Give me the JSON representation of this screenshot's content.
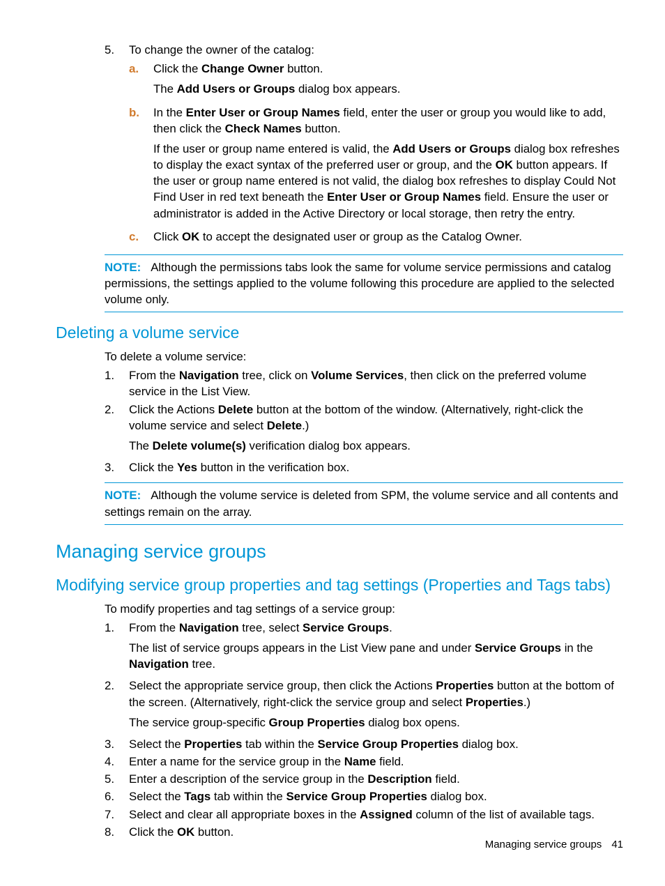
{
  "top": {
    "step5_num": "5.",
    "step5_text": "To change the owner of the catalog:",
    "sub": {
      "a_mk": "a.",
      "a_line1_pre": "Click the ",
      "a_line1_b1": "Change Owner",
      "a_line1_post": " button.",
      "a_line2_pre": "The ",
      "a_line2_b1": "Add Users or Groups",
      "a_line2_post": " dialog box appears.",
      "b_mk": "b.",
      "b_line1_pre": "In the ",
      "b_line1_b1": "Enter User or Group Names",
      "b_line1_mid": " field, enter the user or group you would like to add, then click the ",
      "b_line1_b2": "Check Names",
      "b_line1_post": " button.",
      "b_line2_pre": "If the user or group name entered is valid, the ",
      "b_line2_b1": "Add Users or Groups",
      "b_line2_mid1": " dialog box refreshes to display the exact syntax of the preferred user or group, and the ",
      "b_line2_b2": "OK",
      "b_line2_mid2": " button appears. If the user or group name entered is not valid, the dialog box refreshes to display Could Not Find User in red text beneath the ",
      "b_line2_b3": "Enter User or Group Names",
      "b_line2_post": " field. Ensure the user or administrator is added in the Active Directory or local storage, then retry the entry.",
      "c_mk": "c.",
      "c_line1_pre": "Click ",
      "c_line1_b1": "OK",
      "c_line1_post": " to accept the designated user or group as the Catalog Owner."
    },
    "note1_label": "NOTE:",
    "note1_text": "Although the permissions tabs look the same for volume service permissions and catalog permissions, the settings applied to the volume following this procedure are applied to the selected volume only."
  },
  "del": {
    "heading": "Deleting a volume service",
    "intro": "To delete a volume service:",
    "s1_num": "1.",
    "s1_pre": "From the ",
    "s1_b1": "Navigation",
    "s1_mid": " tree, click on ",
    "s1_b2": "Volume Services",
    "s1_post": ", then click on the preferred volume service in the List View.",
    "s2_num": "2.",
    "s2_pre": "Click the Actions ",
    "s2_b1": "Delete",
    "s2_mid": " button at the bottom of the window. (Alternatively, right-click the volume service and select ",
    "s2_b2": "Delete",
    "s2_post": ".)",
    "s2_line2_pre": "The ",
    "s2_line2_b1": "Delete volume(s)",
    "s2_line2_post": " verification dialog box appears.",
    "s3_num": "3.",
    "s3_pre": "Click the ",
    "s3_b1": "Yes",
    "s3_post": " button in the verification box.",
    "note_label": "NOTE:",
    "note_text": "Although the volume service is deleted from SPM, the volume service and all contents and settings remain on the array."
  },
  "msg": {
    "heading": "Managing service groups"
  },
  "mod": {
    "heading": "Modifying service group properties and tag settings (Properties and Tags tabs)",
    "intro": "To modify properties and tag settings of a service group:",
    "s1_num": "1.",
    "s1_pre": "From the ",
    "s1_b1": "Navigation",
    "s1_mid": " tree, select ",
    "s1_b2": "Service Groups",
    "s1_post": ".",
    "s1_line2_pre": "The list of service groups appears in the List View pane and under ",
    "s1_line2_b1": "Service Groups",
    "s1_line2_mid": " in the ",
    "s1_line2_b2": "Navigation",
    "s1_line2_post": " tree.",
    "s2_num": "2.",
    "s2_pre": "Select the appropriate service group, then click the Actions ",
    "s2_b1": "Properties",
    "s2_mid": " button at the bottom of the screen. (Alternatively, right-click the service group and select ",
    "s2_b2": "Properties",
    "s2_post": ".)",
    "s2_line2_pre": "The service group-specific ",
    "s2_line2_b1": "Group Properties",
    "s2_line2_post": " dialog box opens.",
    "s3_num": "3.",
    "s3_pre": "Select the ",
    "s3_b1": "Properties",
    "s3_mid": " tab within the ",
    "s3_b2": "Service Group Properties",
    "s3_post": " dialog box.",
    "s4_num": "4.",
    "s4_pre": "Enter a name for the service group in the ",
    "s4_b1": "Name",
    "s4_post": " field.",
    "s5_num": "5.",
    "s5_pre": "Enter a description of the service group in the ",
    "s5_b1": "Description",
    "s5_post": " field.",
    "s6_num": "6.",
    "s6_pre": "Select the ",
    "s6_b1": "Tags",
    "s6_mid": " tab within the ",
    "s6_b2": "Service Group Properties",
    "s6_post": " dialog box.",
    "s7_num": "7.",
    "s7_pre": "Select and clear all appropriate boxes in the ",
    "s7_b1": "Assigned",
    "s7_post": " column of the list of available tags.",
    "s8_num": "8.",
    "s8_pre": "Click the ",
    "s8_b1": "OK",
    "s8_post": " button."
  },
  "footer": {
    "text": "Managing service groups",
    "page": "41"
  }
}
